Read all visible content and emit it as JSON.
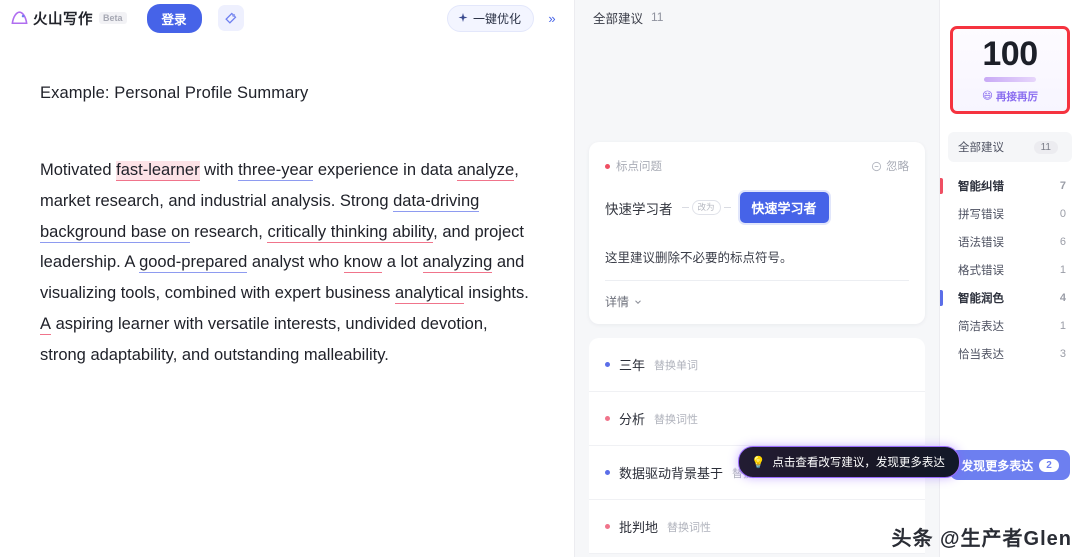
{
  "header": {
    "logo_text": "火山写作",
    "beta_tag": "Beta",
    "login_label": "登录",
    "magic_icon": "magic-wand-icon",
    "optimize_label": "一键优化",
    "optimize_icon": "sparkle-icon",
    "collapse_icon": "chevron-double-right-icon"
  },
  "document": {
    "title": "Example: Personal Profile Summary",
    "paragraph": [
      {
        "text": "Motivated ",
        "mark": "none"
      },
      {
        "text": "fast-learner",
        "mark": "red-highlight"
      },
      {
        "text": " with ",
        "mark": "none"
      },
      {
        "text": "three-year",
        "mark": "blue"
      },
      {
        "text": " experience in data ",
        "mark": "none"
      },
      {
        "text": "analyze",
        "mark": "red"
      },
      {
        "text": ", market research, and industrial analysis. Strong ",
        "mark": "none"
      },
      {
        "text": "data-driving background base on",
        "mark": "blue"
      },
      {
        "text": " research, ",
        "mark": "none"
      },
      {
        "text": "critically thinking ability",
        "mark": "red"
      },
      {
        "text": ", and project leadership. A ",
        "mark": "none"
      },
      {
        "text": "good-prepared",
        "mark": "blue"
      },
      {
        "text": " analyst who ",
        "mark": "none"
      },
      {
        "text": "know",
        "mark": "red"
      },
      {
        "text": " a lot ",
        "mark": "none"
      },
      {
        "text": "analyzing",
        "mark": "red"
      },
      {
        "text": " and visualizing tools, combined with expert business ",
        "mark": "none"
      },
      {
        "text": "analytical",
        "mark": "red"
      },
      {
        "text": " insights. ",
        "mark": "none"
      },
      {
        "text": "A",
        "mark": "red"
      },
      {
        "text": " aspiring learner with versatile interests, undivided devotion, strong adaptability, and outstanding malleability.",
        "mark": "none"
      }
    ]
  },
  "suggestions_panel": {
    "header_label": "全部建议",
    "header_count": "11",
    "card": {
      "tag_label": "标点问题",
      "tag_dot_color": "#ef4f63",
      "ignore_label": "忽略",
      "ignore_icon": "minus-circle-icon",
      "original_text": "快速学习者",
      "mini_pill_label": "改为",
      "suggested_text": "快速学习者",
      "description": "这里建议删除不必要的标点符号。",
      "detail_label": "详情",
      "detail_icon": "chevron-down-icon"
    },
    "rows": [
      {
        "word": "三年",
        "type": "替换单词",
        "dot_color": "#5b6ee8"
      },
      {
        "word": "分析",
        "type": "替换词性",
        "dot_color": "#f0748b"
      },
      {
        "word": "数据驱动背景基于",
        "type": "替换",
        "dot_color": "#5b6ee8"
      },
      {
        "word": "批判地",
        "type": "替换词性",
        "dot_color": "#f0748b"
      }
    ],
    "tooltip": {
      "icon": "lightbulb-icon",
      "text": "点击查看改写建议，发现更多表达"
    }
  },
  "sidebar": {
    "score": {
      "value": "100",
      "emoji": "😄",
      "label": "再接再厉"
    },
    "all_item": {
      "label": "全部建议",
      "count": "11"
    },
    "groups": [
      {
        "label": "智能纠错",
        "count": "7",
        "bar_color": "#ef4f63",
        "children": [
          {
            "label": "拼写错误",
            "count": "0"
          },
          {
            "label": "语法错误",
            "count": "6"
          },
          {
            "label": "格式错误",
            "count": "1"
          }
        ]
      },
      {
        "label": "智能润色",
        "count": "4",
        "bar_color": "#5b6ee8",
        "children": [
          {
            "label": "简洁表达",
            "count": "1"
          },
          {
            "label": "恰当表达",
            "count": "3"
          }
        ]
      }
    ],
    "discover_button": {
      "label": "发现更多表达",
      "badge": "2"
    }
  },
  "watermark": {
    "text": "头条 @生产者Glen"
  },
  "colors": {
    "brand_blue": "#4663e8",
    "accent_purple": "#6d7ff0",
    "error_red": "#ef4f63",
    "annotation_red": "#f5333f",
    "underline_red": "#f0748b",
    "underline_blue": "#8e9bf0"
  }
}
